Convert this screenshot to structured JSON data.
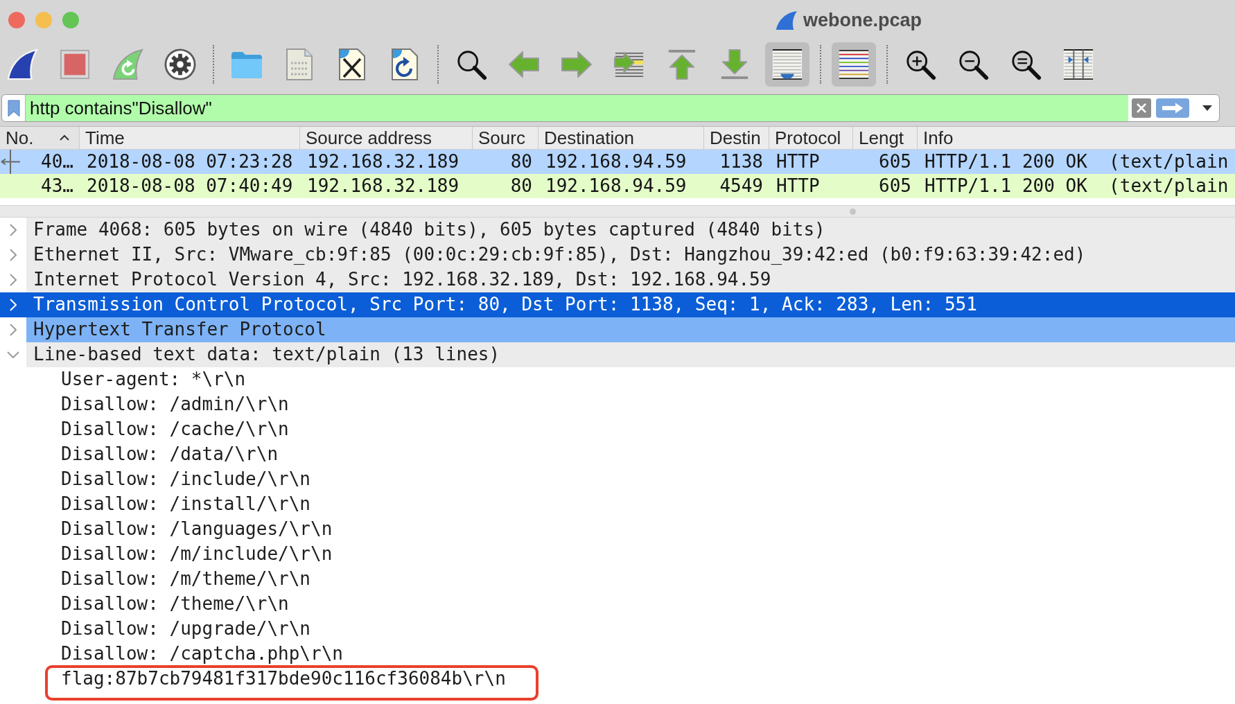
{
  "window": {
    "title": "webone.pcap"
  },
  "toolbar": {
    "groups": [
      {
        "buttons": [
          {
            "kind": "start",
            "pressed": false
          },
          {
            "kind": "stop",
            "pressed": false
          },
          {
            "kind": "restart",
            "pressed": false
          },
          {
            "kind": "options",
            "pressed": false
          }
        ]
      },
      {
        "buttons": [
          {
            "kind": "open",
            "pressed": false
          },
          {
            "kind": "save",
            "pressed": false
          },
          {
            "kind": "close",
            "pressed": false
          },
          {
            "kind": "reload",
            "pressed": false
          }
        ]
      },
      {
        "buttons": [
          {
            "kind": "find",
            "pressed": false
          },
          {
            "kind": "back",
            "pressed": false
          },
          {
            "kind": "forward",
            "pressed": false
          },
          {
            "kind": "goto",
            "pressed": false
          },
          {
            "kind": "first",
            "pressed": false
          },
          {
            "kind": "last",
            "pressed": false
          },
          {
            "kind": "autoscroll",
            "pressed": true
          }
        ]
      },
      {
        "buttons": [
          {
            "kind": "colorize",
            "pressed": true
          }
        ]
      },
      {
        "buttons": [
          {
            "kind": "zoomin",
            "pressed": false
          },
          {
            "kind": "zoomout",
            "pressed": false
          },
          {
            "kind": "zoomreset",
            "pressed": false
          },
          {
            "kind": "resize",
            "pressed": false
          }
        ]
      }
    ]
  },
  "filter": {
    "value": "http contains\"Disallow\"",
    "valid": true
  },
  "packet_list": {
    "columns": [
      {
        "label": "No.",
        "sorted": true
      },
      {
        "label": "Time",
        "sorted": false
      },
      {
        "label": "Source address",
        "sorted": false
      },
      {
        "label": "Sourc",
        "sorted": false
      },
      {
        "label": "Destination",
        "sorted": false
      },
      {
        "label": "Destin",
        "sorted": false
      },
      {
        "label": "Protocol",
        "sorted": false
      },
      {
        "label": "Lengt",
        "sorted": false
      },
      {
        "label": "Info",
        "sorted": false
      }
    ],
    "rows": [
      {
        "selected": true,
        "related": true,
        "cells": [
          "40…",
          "2018-08-08 07:23:28",
          "192.168.32.189",
          "80",
          "192.168.94.59",
          "1138",
          "HTTP",
          "605",
          "HTTP/1.1 200 OK  (text/plain"
        ]
      },
      {
        "selected": false,
        "related": false,
        "cells": [
          "43…",
          "2018-08-08 07:40:49",
          "192.168.32.189",
          "80",
          "192.168.94.59",
          "4549",
          "HTTP",
          "605",
          "HTTP/1.1 200 OK  (text/plain"
        ]
      }
    ]
  },
  "details": {
    "items": [
      {
        "label": "Frame 4068: 605 bytes on wire (4840 bits), 605 bytes captured (4840 bits)",
        "expanded": false,
        "selected": false,
        "highlighted": false
      },
      {
        "label": "Ethernet II, Src: VMware_cb:9f:85 (00:0c:29:cb:9f:85), Dst: Hangzhou_39:42:ed (b0:f9:63:39:42:ed)",
        "expanded": false,
        "selected": false,
        "highlighted": false
      },
      {
        "label": "Internet Protocol Version 4, Src: 192.168.32.189, Dst: 192.168.94.59",
        "expanded": false,
        "selected": false,
        "highlighted": false
      },
      {
        "label": "Transmission Control Protocol, Src Port: 80, Dst Port: 1138, Seq: 1, Ack: 283, Len: 551",
        "expanded": false,
        "selected": true,
        "highlighted": false
      },
      {
        "label": "Hypertext Transfer Protocol",
        "expanded": false,
        "selected": false,
        "highlighted": true
      },
      {
        "label": "Line-based text data: text/plain (13 lines)",
        "expanded": true,
        "selected": false,
        "highlighted": false,
        "children": [
          {
            "label": "User-agent: *\\r\\n",
            "marked": false
          },
          {
            "label": "Disallow: /admin/\\r\\n",
            "marked": false
          },
          {
            "label": "Disallow: /cache/\\r\\n",
            "marked": false
          },
          {
            "label": "Disallow: /data/\\r\\n",
            "marked": false
          },
          {
            "label": "Disallow: /include/\\r\\n",
            "marked": false
          },
          {
            "label": "Disallow: /install/\\r\\n",
            "marked": false
          },
          {
            "label": "Disallow: /languages/\\r\\n",
            "marked": false
          },
          {
            "label": "Disallow: /m/include/\\r\\n",
            "marked": false
          },
          {
            "label": "Disallow: /m/theme/\\r\\n",
            "marked": false
          },
          {
            "label": "Disallow: /theme/\\r\\n",
            "marked": false
          },
          {
            "label": "Disallow: /upgrade/\\r\\n",
            "marked": false
          },
          {
            "label": "Disallow: /captcha.php\\r\\n",
            "marked": false
          },
          {
            "label": "flag:87b7cb79481f317bde90c116cf36084b\\r\\n",
            "marked": true
          }
        ]
      }
    ]
  }
}
